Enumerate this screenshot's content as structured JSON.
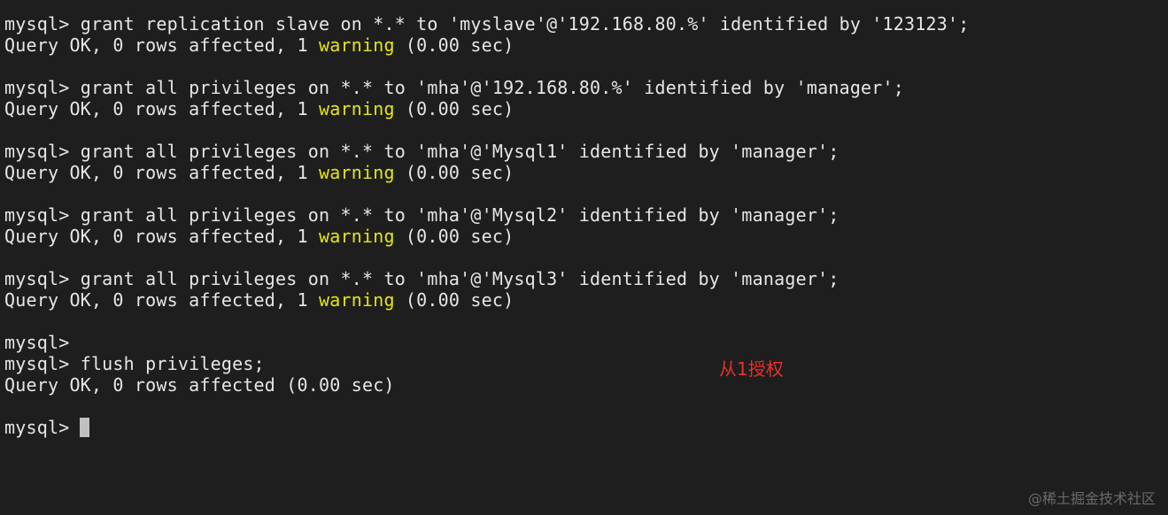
{
  "terminal": {
    "prompt": "mysql>",
    "lines": [
      {
        "cmd": "grant replication slave on *.* to 'myslave'@'192.168.80.%' identified by '123123';"
      },
      {
        "res_pre": "Query OK, 0 rows affected, 1 ",
        "res_warn": "warning",
        "res_post": " (0.00 sec)"
      },
      {
        "cmd": "grant all privileges on *.* to 'mha'@'192.168.80.%' identified by 'manager';"
      },
      {
        "res_pre": "Query OK, 0 rows affected, 1 ",
        "res_warn": "warning",
        "res_post": " (0.00 sec)"
      },
      {
        "cmd": "grant all privileges on *.* to 'mha'@'Mysql1' identified by 'manager';"
      },
      {
        "res_pre": "Query OK, 0 rows affected, 1 ",
        "res_warn": "warning",
        "res_post": " (0.00 sec)"
      },
      {
        "cmd": "grant all privileges on *.* to 'mha'@'Mysql2' identified by 'manager';"
      },
      {
        "res_pre": "Query OK, 0 rows affected, 1 ",
        "res_warn": "warning",
        "res_post": " (0.00 sec)"
      },
      {
        "cmd": "grant all privileges on *.* to 'mha'@'Mysql3' identified by 'manager';"
      },
      {
        "res_pre": "Query OK, 0 rows affected, 1 ",
        "res_warn": "warning",
        "res_post": " (0.00 sec)"
      },
      {
        "cmd": ""
      },
      {
        "cmd": "flush privileges;"
      },
      {
        "res": "Query OK, 0 rows affected (0.00 sec)"
      },
      {
        "cmd": ""
      }
    ]
  },
  "annotation": "从1授权",
  "watermark": "@稀土掘金技术社区",
  "colors": {
    "background": "#1e1e1e",
    "text": "#e6e6e6",
    "warning": "#e5e510",
    "annotation": "#e8302a"
  }
}
